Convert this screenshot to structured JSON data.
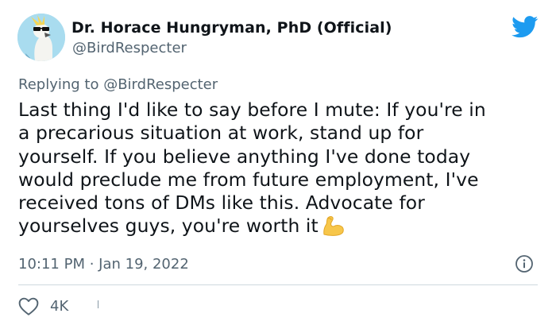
{
  "author": {
    "display_name": "Dr. Horace Hungryman, PhD (Official)",
    "handle": "@BirdRespecter"
  },
  "reply": {
    "prefix": "Replying to ",
    "mention": "@BirdRespecter"
  },
  "tweet": {
    "lines": [
      "Last thing I'd like to say before I mute: If you're in",
      "a precarious situation at work, stand up for",
      "yourself. If you believe anything I've done today",
      "would preclude me from future employment, I've",
      "received tons of DMs like this. Advocate for",
      "yourselves guys, you're worth it"
    ],
    "emoji": "flexed-biceps-emoji",
    "timestamp": "10:11 PM · Jan 19, 2022"
  },
  "engagement": {
    "likes": "4K"
  },
  "icons": {
    "brand": "twitter-bird-icon",
    "info": "info-icon",
    "like": "heart-icon"
  },
  "colors": {
    "brand_blue": "#1d9bf0",
    "secondary_text": "#536471",
    "primary_text": "#0f1419",
    "divider": "#cfd9de"
  }
}
